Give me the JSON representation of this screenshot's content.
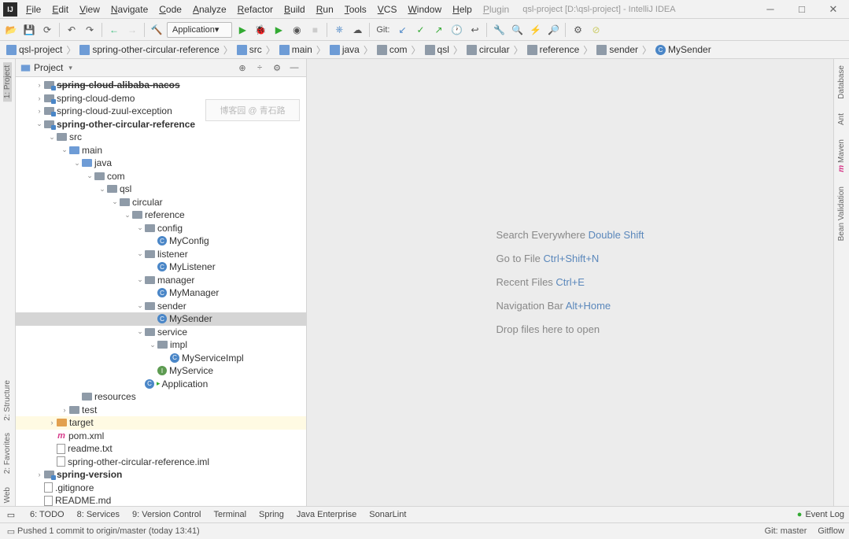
{
  "title": "qsl-project [D:\\qsl-project] - IntelliJ IDEA",
  "menu": [
    "File",
    "Edit",
    "View",
    "Navigate",
    "Code",
    "Analyze",
    "Refactor",
    "Build",
    "Run",
    "Tools",
    "VCS",
    "Window",
    "Help",
    "Plugin"
  ],
  "runconfig": "Application",
  "git_label": "Git:",
  "breadcrumb": [
    {
      "icon": "module",
      "label": "qsl-project"
    },
    {
      "icon": "module",
      "label": "spring-other-circular-reference"
    },
    {
      "icon": "folder-blue",
      "label": "src"
    },
    {
      "icon": "folder-blue",
      "label": "main"
    },
    {
      "icon": "folder-blue",
      "label": "java"
    },
    {
      "icon": "folder-gray",
      "label": "com"
    },
    {
      "icon": "folder-gray",
      "label": "qsl"
    },
    {
      "icon": "folder-gray",
      "label": "circular"
    },
    {
      "icon": "folder-gray",
      "label": "reference"
    },
    {
      "icon": "folder-gray",
      "label": "sender"
    },
    {
      "icon": "class",
      "label": "MySender"
    }
  ],
  "proj_label": "Project",
  "watermark": "博客园 @ 青石路",
  "tree": [
    {
      "indent": 1,
      "arrow": ">",
      "icon": "module",
      "label": "spring-cloud-alibaba-nacos",
      "bold": true,
      "cut": true
    },
    {
      "indent": 1,
      "arrow": ">",
      "icon": "module",
      "label": "spring-cloud-demo"
    },
    {
      "indent": 1,
      "arrow": ">",
      "icon": "module",
      "label": "spring-cloud-zuul-exception"
    },
    {
      "indent": 1,
      "arrow": "v",
      "icon": "module",
      "label": "spring-other-circular-reference",
      "bold": true
    },
    {
      "indent": 2,
      "arrow": "v",
      "icon": "folder",
      "label": "src"
    },
    {
      "indent": 3,
      "arrow": "v",
      "icon": "folder-blue",
      "label": "main"
    },
    {
      "indent": 4,
      "arrow": "v",
      "icon": "folder-blue",
      "label": "java"
    },
    {
      "indent": 5,
      "arrow": "v",
      "icon": "folder",
      "label": "com"
    },
    {
      "indent": 6,
      "arrow": "v",
      "icon": "folder",
      "label": "qsl"
    },
    {
      "indent": 7,
      "arrow": "v",
      "icon": "folder",
      "label": "circular"
    },
    {
      "indent": 8,
      "arrow": "v",
      "icon": "folder",
      "label": "reference"
    },
    {
      "indent": 9,
      "arrow": "v",
      "icon": "folder",
      "label": "config"
    },
    {
      "indent": 10,
      "arrow": "",
      "icon": "class",
      "label": "MyConfig"
    },
    {
      "indent": 9,
      "arrow": "v",
      "icon": "folder",
      "label": "listener"
    },
    {
      "indent": 10,
      "arrow": "",
      "icon": "class",
      "label": "MyListener"
    },
    {
      "indent": 9,
      "arrow": "v",
      "icon": "folder",
      "label": "manager"
    },
    {
      "indent": 10,
      "arrow": "",
      "icon": "class",
      "label": "MyManager"
    },
    {
      "indent": 9,
      "arrow": "v",
      "icon": "folder",
      "label": "sender"
    },
    {
      "indent": 10,
      "arrow": "",
      "icon": "class",
      "label": "MySender",
      "sel": true
    },
    {
      "indent": 9,
      "arrow": "v",
      "icon": "folder",
      "label": "service"
    },
    {
      "indent": 10,
      "arrow": "v",
      "icon": "folder",
      "label": "impl"
    },
    {
      "indent": 11,
      "arrow": "",
      "icon": "class",
      "label": "MyServiceImpl"
    },
    {
      "indent": 10,
      "arrow": "",
      "icon": "iface",
      "label": "MyService"
    },
    {
      "indent": 9,
      "arrow": "",
      "icon": "class",
      "label": "Application",
      "runnable": true
    },
    {
      "indent": 4,
      "arrow": "",
      "icon": "folder",
      "label": "resources"
    },
    {
      "indent": 3,
      "arrow": ">",
      "icon": "folder",
      "label": "test"
    },
    {
      "indent": 2,
      "arrow": ">",
      "icon": "folder-orange",
      "label": "target",
      "hilite": true
    },
    {
      "indent": 2,
      "arrow": "",
      "icon": "maven",
      "label": "pom.xml"
    },
    {
      "indent": 2,
      "arrow": "",
      "icon": "file",
      "label": "readme.txt"
    },
    {
      "indent": 2,
      "arrow": "",
      "icon": "file",
      "label": "spring-other-circular-reference.iml"
    },
    {
      "indent": 1,
      "arrow": ">",
      "icon": "module",
      "label": "spring-version",
      "bold": true
    },
    {
      "indent": 1,
      "arrow": "",
      "icon": "file",
      "label": ".gitignore"
    },
    {
      "indent": 1,
      "arrow": "",
      "icon": "file",
      "label": "README.md"
    }
  ],
  "hints": [
    {
      "text": "Search Everywhere",
      "sc": "Double Shift"
    },
    {
      "text": "Go to File",
      "sc": "Ctrl+Shift+N"
    },
    {
      "text": "Recent Files",
      "sc": "Ctrl+E"
    },
    {
      "text": "Navigation Bar",
      "sc": "Alt+Home"
    },
    {
      "text": "Drop files here to open",
      "sc": ""
    }
  ],
  "left_tools": [
    "1: Project"
  ],
  "left_tools_bottom": [
    "2: Structure",
    "2: Favorites",
    "Web"
  ],
  "right_tools": [
    "Database",
    "Ant",
    "Maven",
    "Bean Validation"
  ],
  "bottom_tools": [
    {
      "label": "6: TODO"
    },
    {
      "label": "8: Services"
    },
    {
      "label": "9: Version Control"
    },
    {
      "label": "Terminal"
    },
    {
      "label": "Spring"
    },
    {
      "label": "Java Enterprise"
    },
    {
      "label": "SonarLint"
    }
  ],
  "event_log": "Event Log",
  "status_text": "Pushed 1 commit to origin/master (today 13:41)",
  "status_git": "Git: master",
  "status_gitflow": "Gitflow"
}
